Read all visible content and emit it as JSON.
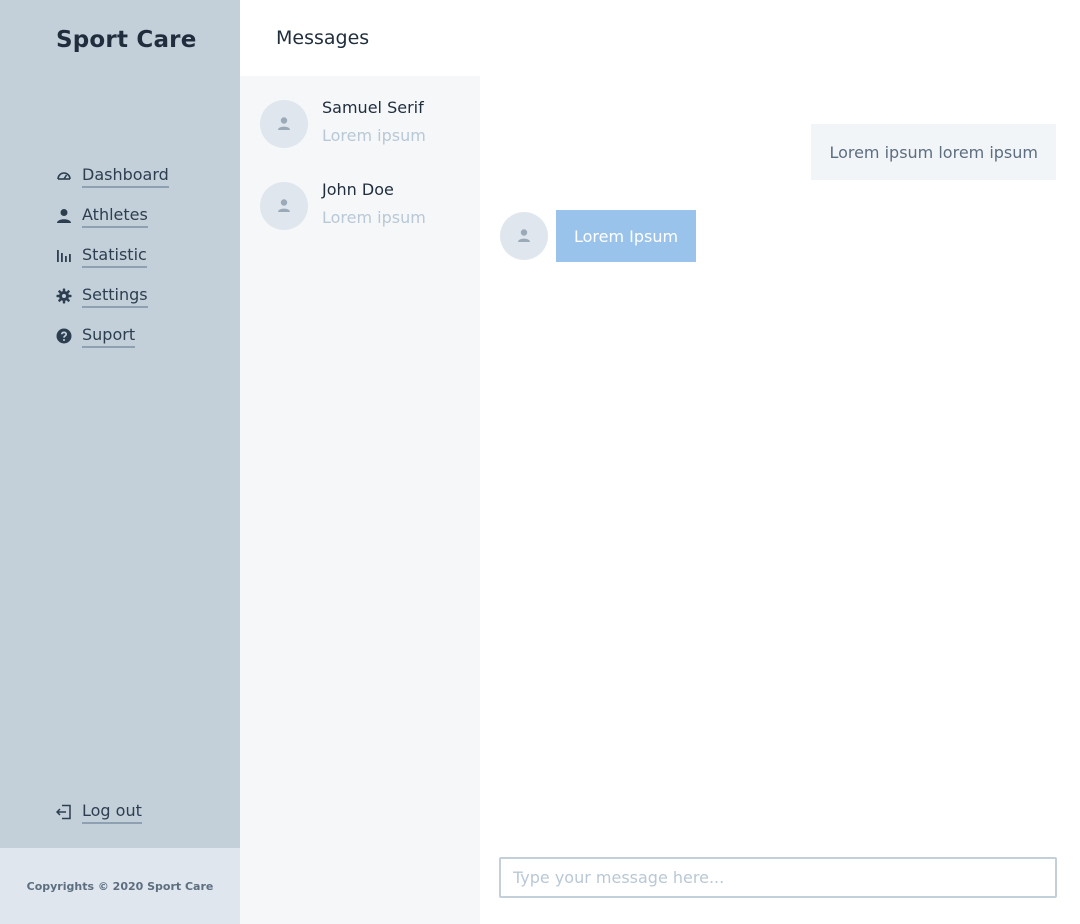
{
  "app": {
    "name": "Sport Care"
  },
  "sidebar": {
    "items": [
      {
        "label": "Dashboard",
        "icon": "dashboard-icon"
      },
      {
        "label": "Athletes",
        "icon": "person-icon"
      },
      {
        "label": "Statistic",
        "icon": "bar-chart-icon"
      },
      {
        "label": "Settings",
        "icon": "gear-icon"
      },
      {
        "label": "Suport",
        "icon": "help-icon"
      }
    ],
    "logout": {
      "label": "Log out",
      "icon": "logout-icon"
    },
    "footer": "Copyrights © 2020 Sport Care"
  },
  "messages": {
    "title": "Messages",
    "contacts": [
      {
        "name": "Samuel Serif",
        "preview": "Lorem ipsum"
      },
      {
        "name": "John Doe",
        "preview": "Lorem ipsum"
      }
    ],
    "thread": {
      "sent": "Lorem ipsum lorem ipsum",
      "received": "Lorem Ipsum"
    },
    "composer": {
      "placeholder": "Type your message here..."
    }
  },
  "colors": {
    "sidebar_bg": "#c4d0d9",
    "accent_bubble": "#99c3ea",
    "text_dark": "#1f2d3d",
    "muted": "#b9c8d6"
  }
}
